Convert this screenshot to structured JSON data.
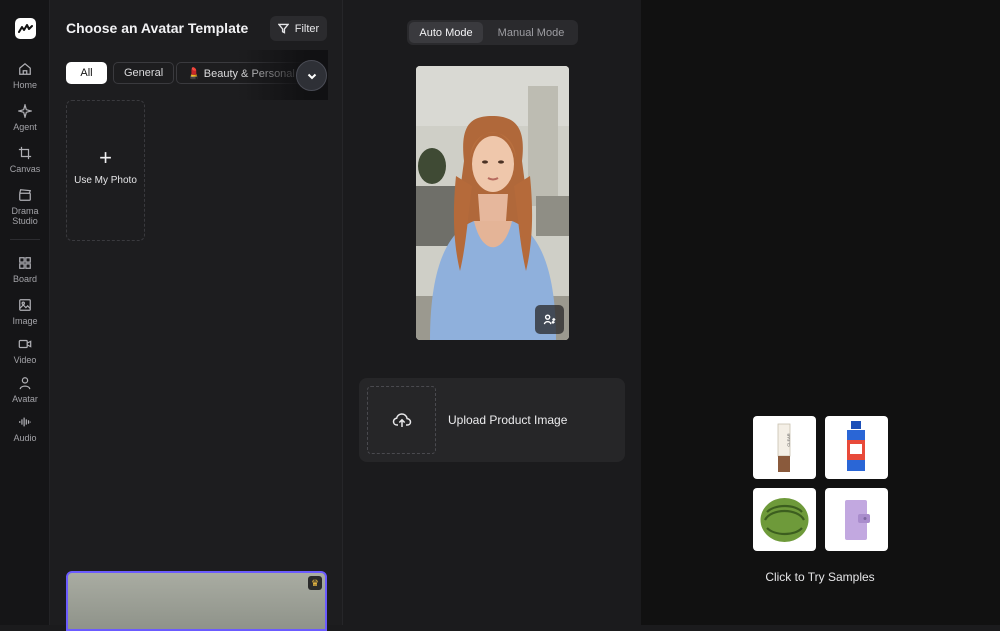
{
  "rail": {
    "items": [
      {
        "label": "Home",
        "icon": "home-icon"
      },
      {
        "label": "Agent",
        "icon": "sparkle-icon"
      },
      {
        "label": "Canvas",
        "icon": "crop-icon"
      },
      {
        "label": "Drama Studio",
        "icon": "clapperboard-icon"
      },
      {
        "label": "Board",
        "icon": "grid-icon"
      },
      {
        "label": "Image",
        "icon": "image-icon"
      },
      {
        "label": "Video",
        "icon": "video-icon"
      },
      {
        "label": "Avatar",
        "icon": "person-icon"
      },
      {
        "label": "Audio",
        "icon": "waveform-icon"
      }
    ]
  },
  "panel": {
    "title": "Choose an Avatar Template",
    "filter_label": "Filter",
    "chips": [
      "All",
      "General",
      "💄 Beauty & Personal Care"
    ],
    "use_photo_label": "Use My Photo",
    "accent": "#6b5bff"
  },
  "center": {
    "modes": [
      "Auto Mode",
      "Manual Mode"
    ],
    "active_mode": "Auto Mode",
    "upload_label": "Upload Product Image"
  },
  "right": {
    "samples_label": "Click to Try Samples",
    "samples": [
      "sunscreen-tube",
      "stain-remover-bottle",
      "watermelon",
      "purple-wallet"
    ]
  }
}
